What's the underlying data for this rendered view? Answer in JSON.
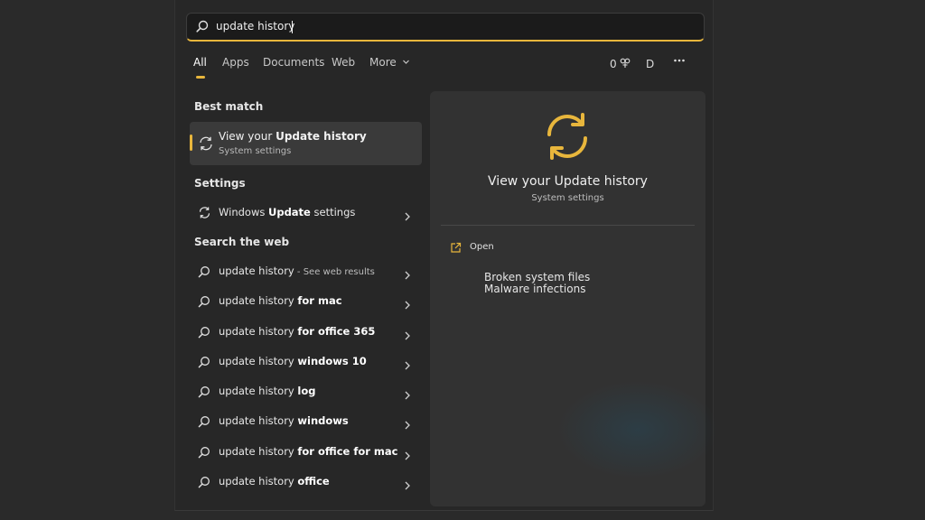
{
  "search": {
    "query": "update history"
  },
  "tabs": [
    {
      "label": "All"
    },
    {
      "label": "Apps"
    },
    {
      "label": "Documents"
    },
    {
      "label": "Web"
    },
    {
      "label": "More"
    }
  ],
  "toolbar": {
    "rewards_count": "0",
    "avatar_initial": "D"
  },
  "best_match": {
    "heading": "Best match",
    "title_prefix": "View your ",
    "title_bold": "Update history",
    "subtitle": "System settings"
  },
  "settings": {
    "heading": "Settings",
    "items": [
      {
        "prefix": "Windows ",
        "bold": "Update",
        "suffix": " settings"
      }
    ]
  },
  "web": {
    "heading": "Search the web",
    "items": [
      {
        "prefix": "update history",
        "bold": "",
        "muted": " - See web results"
      },
      {
        "prefix": "update history ",
        "bold": "for mac",
        "muted": ""
      },
      {
        "prefix": "update history ",
        "bold": "for office 365",
        "muted": ""
      },
      {
        "prefix": "update history ",
        "bold": "windows 10",
        "muted": ""
      },
      {
        "prefix": "update history ",
        "bold": "log",
        "muted": ""
      },
      {
        "prefix": "update history ",
        "bold": "windows",
        "muted": ""
      },
      {
        "prefix": "update history ",
        "bold": "for office for mac",
        "muted": ""
      },
      {
        "prefix": "update history ",
        "bold": "office",
        "muted": ""
      }
    ]
  },
  "preview": {
    "title": "View your Update history",
    "subtitle": "System settings",
    "open_label": "Open",
    "notes": [
      "Broken system files",
      "Malware infections"
    ]
  },
  "colors": {
    "accent": "#e8b63c",
    "panel": "#272727",
    "preview": "#323232"
  },
  "icons": [
    "search-icon",
    "refresh-icon",
    "chevron-right-icon",
    "chevron-down-icon",
    "rewards-icon",
    "more-icon",
    "open-external-icon"
  ]
}
